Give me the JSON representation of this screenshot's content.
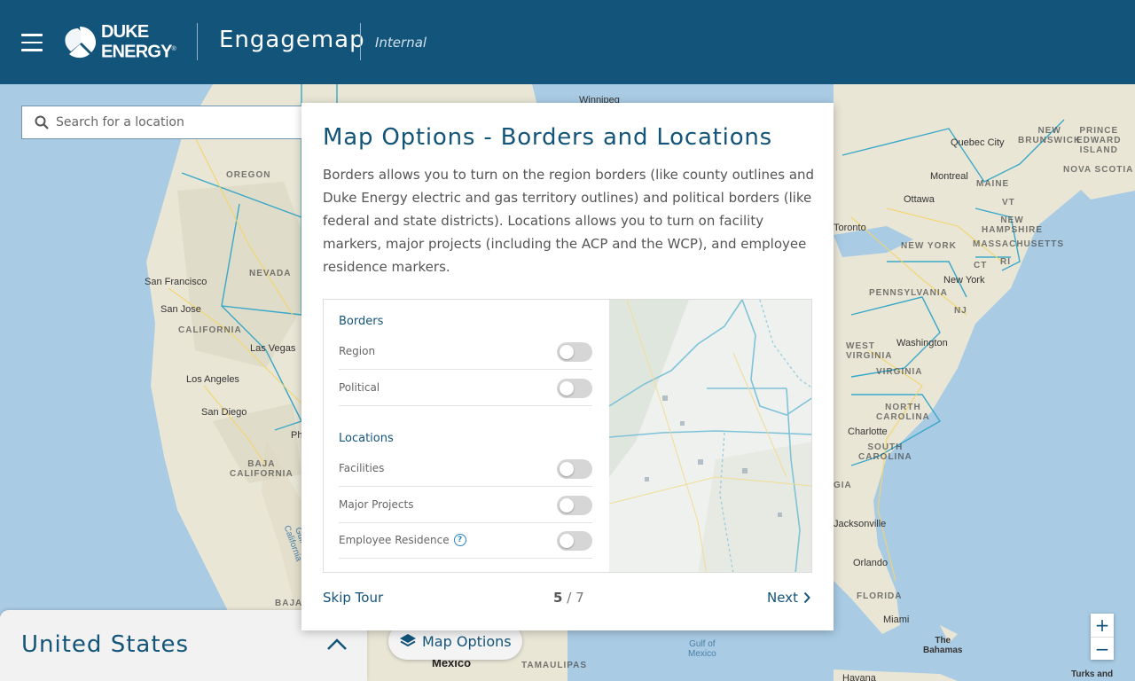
{
  "header": {
    "brand_line1": "DUKE",
    "brand_line2": "ENERGY",
    "brand_mark": "®",
    "app_title": "Engagemap",
    "env_label": "Internal"
  },
  "search": {
    "placeholder": "Search for a location"
  },
  "map": {
    "cities": [
      "Winnipeg",
      "Quebec City",
      "Montreal",
      "Ottawa",
      "Toronto",
      "New York",
      "Washington",
      "Charlotte",
      "Jacksonville",
      "Orlando",
      "Miami",
      "San Francisco",
      "San Jose",
      "Las Vegas",
      "Los Angeles",
      "San Diego",
      "Havana"
    ],
    "regions": [
      "OREGON",
      "NEVADA",
      "CALIFORNIA",
      "BAJA\nCALIFORNIA",
      "PRINCE\nEDWARD\nISLAND",
      "NEW\nBRUNSWICK",
      "NOVA SCOTIA",
      "MAINE",
      "NEW\nHAMPSHIRE",
      "MASSACHUSETTS",
      "NEW YORK",
      "CT",
      "RI",
      "PENNSYLVANIA",
      "NJ",
      "WEST\nVIRGINIA",
      "VIRGINIA",
      "NORTH\nCAROLINA",
      "SOUTH\nCAROLINA",
      "GIA",
      "FLORIDA",
      "BAJA",
      "TAMAULIPAS",
      "VT"
    ],
    "waters": [
      "Gulf of\nMexico",
      "Gulf of\nCalifornia"
    ],
    "countries": [
      "Mexico",
      "The\nBahamas",
      "Turks and"
    ],
    "partial": [
      "Ph"
    ]
  },
  "region_panel": {
    "name": "United States"
  },
  "map_options": {
    "label": "Map Options"
  },
  "zoom": {
    "in": "+",
    "out": "−"
  },
  "tour": {
    "title": "Map Options - Borders and Locations",
    "body": "Borders allows you to turn on the region borders (like county outlines and Duke Energy electric and gas territory outlines) and political borders (like federal and state districts). Locations allows you to turn on  facility markers, major projects (including the ACP and the WCP), and employee residence markers.",
    "preview": {
      "borders_heading": "Borders",
      "borders": [
        {
          "label": "Region",
          "on": false
        },
        {
          "label": "Political",
          "on": false
        }
      ],
      "locations_heading": "Locations",
      "locations": [
        {
          "label": "Facilities",
          "on": false
        },
        {
          "label": "Major Projects",
          "on": false
        },
        {
          "label": "Employee Residence",
          "on": false
        }
      ],
      "help": "?"
    },
    "skip": "Skip Tour",
    "current_step": "5",
    "separator": "/",
    "total_steps": "7",
    "next": "Next"
  },
  "colors": {
    "header": "#13547a",
    "accent": "#13547a",
    "water": "#a9cbe4",
    "land": "#e9e6d6",
    "border": "#3aa8c8"
  }
}
